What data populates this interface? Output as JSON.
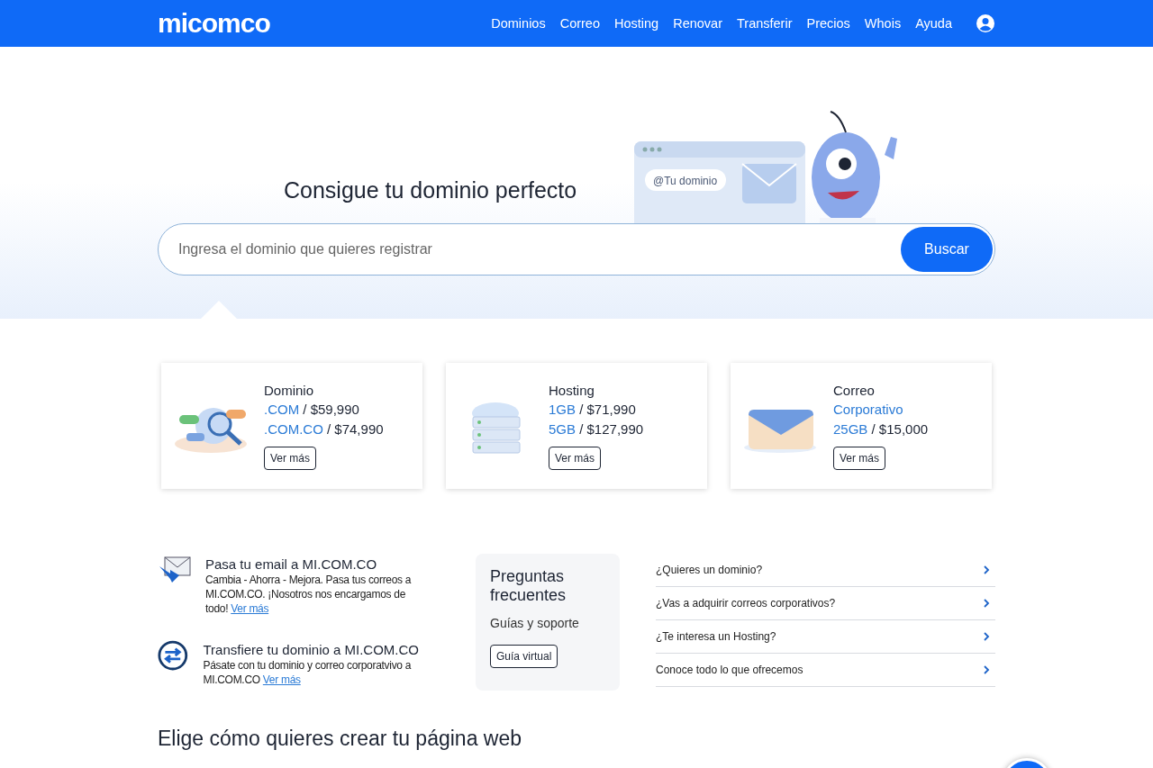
{
  "header": {
    "logo": "micomco",
    "nav": [
      "Dominios",
      "Correo",
      "Hosting",
      "Renovar",
      "Transferir",
      "Precios",
      "Whois",
      "Ayuda"
    ]
  },
  "hero": {
    "title": "Consigue tu dominio perfecto",
    "illustration_text": "@Tu dominio",
    "search": {
      "placeholder": "Ingresa el dominio que quieres registrar",
      "button": "Buscar"
    }
  },
  "products": [
    {
      "kind": "domain",
      "title": "Dominio",
      "lines": [
        {
          "highlight": ".COM",
          "price": " / $59,990"
        },
        {
          "highlight": ".COM.CO",
          "price": " / $74,990"
        }
      ],
      "button": "Ver más"
    },
    {
      "kind": "hosting",
      "title": "Hosting",
      "lines": [
        {
          "highlight": "1GB",
          "price": " / $71,990"
        },
        {
          "highlight": "5GB",
          "price": " / $127,990"
        }
      ],
      "button": "Ver más"
    },
    {
      "kind": "mail",
      "title": "Correo",
      "lines": [
        {
          "highlight": "Corporativo"
        },
        {
          "highlight": "25GB",
          "price": " / $15,000"
        }
      ],
      "button": "Ver más"
    }
  ],
  "promos": [
    {
      "kind": "mail",
      "title": "Pasa tu email a MI.COM.CO",
      "text": "Cambia - Ahorra - Mejora. Pasa tus correos a MI.COM.CO. ¡Nosotros nos encargamos de todo!",
      "link": "Ver más"
    },
    {
      "kind": "transfer",
      "title": "Transfiere tu dominio a MI.COM.CO",
      "text": "Pásate con tu dominio y correo corporatvivo a MI.COM.CO",
      "link": "Ver más"
    }
  ],
  "faq_box": {
    "title": "Preguntas frecuentes",
    "subtitle": "Guías y soporte",
    "button": "Guía virtual"
  },
  "faq_list": [
    "¿Quieres un dominio?",
    "¿Vas a adquirir correos corporativos?",
    "¿Te interesa un Hosting?",
    "Conoce todo lo que ofrecemos"
  ],
  "next_section": {
    "title": "Elige cómo quieres crear tu página web"
  }
}
